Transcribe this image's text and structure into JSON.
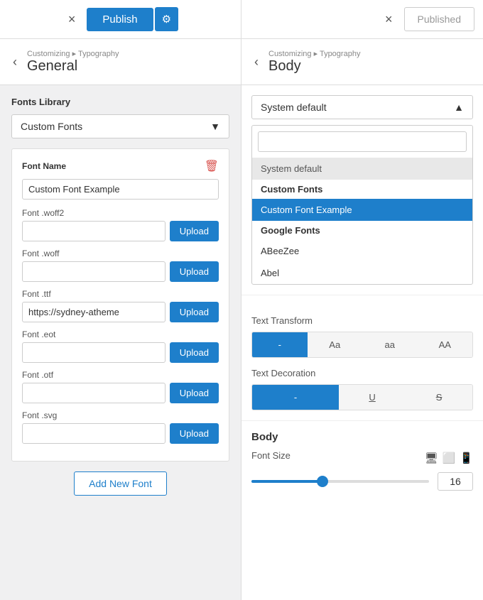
{
  "topbar": {
    "left": {
      "close_label": "×",
      "publish_label": "Publish",
      "gear_label": "⚙"
    },
    "right": {
      "close_label": "×",
      "published_label": "Published"
    }
  },
  "left_panel": {
    "breadcrumb": {
      "path": "Customizing ▸ Typography",
      "title": "General"
    },
    "fonts_library_label": "Fonts Library",
    "dropdown_label": "Custom Fonts",
    "dropdown_arrow": "▼",
    "font_card": {
      "font_name_label": "Font Name",
      "font_name_value": "Custom Font Example",
      "font_woff2_label": "Font .woff2",
      "font_woff2_value": "",
      "font_woff_label": "Font .woff",
      "font_woff_value": "",
      "font_ttf_label": "Font .ttf",
      "font_ttf_value": "https://sydney-atheme",
      "font_eot_label": "Font .eot",
      "font_eot_value": "",
      "font_otf_label": "Font .otf",
      "font_otf_value": "",
      "font_svg_label": "Font .svg",
      "font_svg_value": "",
      "upload_label": "Upload",
      "delete_icon": "🗑"
    },
    "add_new_font_label": "Add New Font"
  },
  "right_panel": {
    "breadcrumb": {
      "path": "Customizing ▸ Typography",
      "title": "Body"
    },
    "system_default_label": "System default",
    "dropdown_arrow": "▲",
    "search_placeholder": "",
    "dropdown_options": {
      "system_default": "System default",
      "custom_fonts_group": "Custom Fonts",
      "custom_font_example": "Custom Font Example",
      "google_fonts_group": "Google Fonts",
      "abeezee": "ABeeZee",
      "abel": "Abel"
    },
    "text_transform_label": "Text Transform",
    "transform_buttons": [
      {
        "label": "-",
        "active": true
      },
      {
        "label": "Aa",
        "active": false
      },
      {
        "label": "aa",
        "active": false
      },
      {
        "label": "AA",
        "active": false
      }
    ],
    "text_decoration_label": "Text Decoration",
    "decoration_buttons": [
      {
        "label": "-",
        "active": true
      },
      {
        "label": "U̲",
        "active": false
      },
      {
        "label": "S",
        "active": false
      }
    ],
    "body_title": "Body",
    "font_size_label": "Font Size",
    "font_size_value": "16",
    "slider_percent": 40,
    "device_icons": [
      "🖥",
      "📱",
      "📱"
    ]
  }
}
